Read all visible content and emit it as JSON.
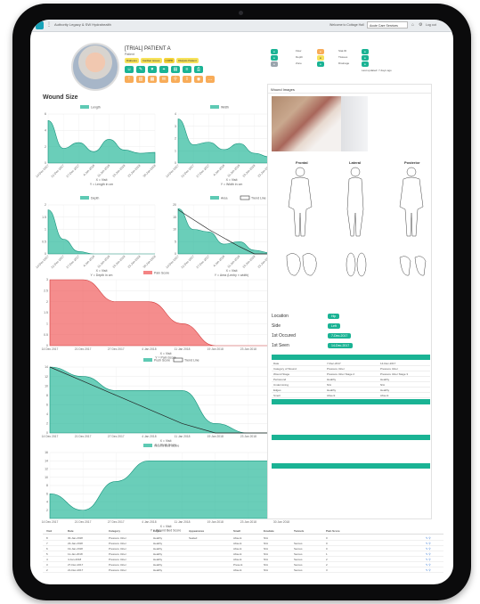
{
  "app": {
    "breadcrumb": "Authority Legacy & SW Hydrahealth",
    "welcome": "Welcome to Cottage Hall",
    "service_select": "Acute Care Services",
    "logout": "Log out"
  },
  "patient": {
    "name": "[TRIAL] PATIENT A",
    "subtitle": "Patient",
    "tags": [
      "Diabetes",
      "Cardiac issues",
      "COPD",
      "Dialysis Patient"
    ]
  },
  "info": {
    "labels": [
      "Flow",
      "Depth",
      "Zone",
      "Stat.ID",
      "Tissues",
      "Drainage"
    ],
    "last_updated": "Last updated: 7 days ago"
  },
  "wound_size_title": "Wound Size",
  "dates_short": [
    "14-Dec-2017",
    "21-Dec-2017",
    "27-Dec-2017",
    "4-Jan-2018",
    "11-Jan-2018",
    "19-Jan-2018",
    "23-Jan-2018",
    "30-Jan-2018"
  ],
  "dates_long": [
    "14 Dec 2017",
    "21 Dec 2017",
    "27 Dec 2017",
    "4 Jan 2018",
    "11 Jan 2018",
    "19 Jan 2018",
    "23 Jan 2018",
    "30 Jan 2018"
  ],
  "chart_data": [
    {
      "type": "area",
      "title": "Length",
      "x": [
        "14-Dec-2017",
        "21-Dec-2017",
        "27-Dec-2017",
        "4-Jan-2018",
        "11-Jan-2018",
        "19-Jan-2018",
        "23-Jan-2018",
        "30-Jan-2018"
      ],
      "series": [
        {
          "name": "Length",
          "values": [
            5.2,
            1.8,
            2.5,
            1.4,
            2.9,
            1.6,
            1.2,
            1.3
          ]
        }
      ],
      "xlabel": "X = Visit",
      "ylabel": "Y = Length in cm",
      "ylim": [
        0,
        6
      ]
    },
    {
      "type": "area",
      "title": "Width",
      "x": [
        "14-Dec-2017",
        "21-Dec-2017",
        "27-Dec-2017",
        "4-Jan-2018",
        "11-Jan-2018",
        "19-Jan-2018",
        "23-Jan-2018",
        "30-Jan-2018"
      ],
      "series": [
        {
          "name": "Width",
          "values": [
            3.6,
            1.5,
            1.7,
            1.1,
            1.6,
            0.8,
            0.5,
            0.4
          ]
        }
      ],
      "xlabel": "X = Visit",
      "ylabel": "Y = Width in cm",
      "ylim": [
        0,
        4
      ]
    },
    {
      "type": "area",
      "title": "Depth",
      "x": [
        "14-Dec-2017",
        "21-Dec-2017",
        "27-Dec-2017",
        "4-Jan-2018",
        "11-Jan-2018",
        "19-Jan-2018",
        "23-Jan-2018",
        "30-Jan-2018"
      ],
      "series": [
        {
          "name": "Depth",
          "values": [
            1.8,
            0.6,
            0.1,
            0.0,
            0.0,
            0.0,
            0.0,
            0.0
          ]
        }
      ],
      "xlabel": "X = Visit",
      "ylabel": "Y = Depth in cm",
      "ylim": [
        0,
        2
      ]
    },
    {
      "type": "area",
      "title": "Area / Trend Line",
      "x": [
        "14-Dec-2017",
        "21-Dec-2017",
        "27-Dec-2017",
        "4-Jan-2018",
        "11-Jan-2018",
        "19-Jan-2018",
        "23-Jan-2018",
        "30-Jan-2018"
      ],
      "series": [
        {
          "name": "Area",
          "values": [
            18.5,
            10.0,
            9.0,
            4.0,
            5.0,
            1.5,
            0.5,
            0.5
          ]
        },
        {
          "name": "Trend Line",
          "values": [
            18.0,
            14.0,
            10.0,
            6.5,
            3.0,
            0.0,
            0.0,
            0.0
          ]
        }
      ],
      "xlabel": "X = Visit",
      "ylabel": "Y = Area (Lenby × width)",
      "ylim": [
        0,
        20
      ]
    },
    {
      "type": "area",
      "title": "Pain Score",
      "x": [
        "14 Dec 2017",
        "21 Dec 2017",
        "27 Dec 2017",
        "4 Jan 2018",
        "11 Jan 2018",
        "19 Jan 2018",
        "23 Jan 2018",
        "30 Jan 2018"
      ],
      "series": [
        {
          "name": "Pain Score",
          "values": [
            3.0,
            3.0,
            2.0,
            2.0,
            1.0,
            0.0,
            0.0,
            0.0
          ]
        }
      ],
      "xlabel": "X = Visit",
      "ylabel": "Y = Pain Score",
      "ylim": [
        0,
        3
      ]
    },
    {
      "type": "area",
      "title": "Push Score / Trend Line",
      "x": [
        "14 Dec 2017",
        "21 Dec 2017",
        "27 Dec 2017",
        "4 Jan 2018",
        "11 Jan 2018",
        "19 Jan 2018",
        "23 Jan 2018",
        "30 Jan 2018"
      ],
      "series": [
        {
          "name": "Push Score",
          "values": [
            14,
            12,
            9,
            9,
            9,
            2,
            0,
            0
          ]
        },
        {
          "name": "Trend Line",
          "values": [
            14,
            11,
            8,
            5,
            2,
            0,
            0,
            0
          ]
        }
      ],
      "xlabel": "X = Visit",
      "ylabel": "Y = Push Score",
      "ylim": [
        0,
        14
      ]
    },
    {
      "type": "area",
      "title": "Wound Bed Score",
      "x": [
        "14 Dec 2017",
        "21 Dec 2017",
        "27 Dec 2017",
        "4 Jan 2018",
        "11 Jan 2018",
        "19 Jan 2018",
        "23 Jan 2018",
        "30 Jan 2018"
      ],
      "series": [
        {
          "name": "Wound Bed Score",
          "values": [
            6,
            2,
            9,
            14,
            14,
            14,
            14,
            14
          ]
        }
      ],
      "xlabel": "X = Visit",
      "ylabel": "Y = Wound Bed Score",
      "ylim": [
        0,
        16
      ]
    }
  ],
  "right_panel": {
    "title": "Wound Images",
    "views": [
      "Frontal",
      "Lateral",
      "Posterior"
    ],
    "location_label": "Location",
    "location_value": "Hip",
    "side_label": "Side",
    "side_value": "Left",
    "occurred_label": "1st Occured",
    "occurred_value": "7-Dec-2017",
    "seen_label": "1st Seen",
    "seen_value": "14-Dec-2017"
  },
  "assessment_rows": [
    [
      "Date",
      "7-Dec-2017",
      "14-Dec-2017"
    ],
    [
      "Category of Wound",
      "Pressure Ulcer",
      "Pressure Ulcer"
    ],
    [
      "Wound Stage",
      "Pressure Ulcer Stage 2",
      "Pressure Ulcer Stage 3"
    ],
    [
      "Periwound",
      "Healthy",
      "Healthy"
    ],
    [
      "Undermining",
      "N/A",
      "N/A"
    ],
    [
      "Edges",
      "Healthy",
      "Healthy"
    ],
    [
      "Smell",
      "Absent",
      "Absent"
    ]
  ],
  "bottom_table": {
    "headers": [
      "Visit",
      "Date",
      "Category",
      "Edges",
      "Appearance",
      "Smell",
      "Exudate",
      "Tunnels",
      "Pain Score"
    ],
    "rows": [
      [
        "8",
        "30-Jan-2018",
        "Pressure Ulcer",
        "Healthy",
        "Sealed",
        "Absent",
        "N/A",
        "",
        "0"
      ],
      [
        "7",
        "23-Jan-2018",
        "Pressure Ulcer",
        "Healthy",
        "",
        "Absent",
        "N/A",
        "Serous",
        "0"
      ],
      [
        "6",
        "19-Jan-2018",
        "Pressure Ulcer",
        "Healthy",
        "",
        "Absent",
        "N/A",
        "Serous",
        "0"
      ],
      [
        "5",
        "11-Jan-2018",
        "Pressure Ulcer",
        "Healthy",
        "",
        "Absent",
        "N/A",
        "Serous",
        "1"
      ],
      [
        "4",
        "4-Jan-2018",
        "Pressure Ulcer",
        "Healthy",
        "",
        "Absent",
        "N/A",
        "Serous",
        "2"
      ],
      [
        "3",
        "27-Dec-2017",
        "Pressure Ulcer",
        "Healthy",
        "",
        "Present",
        "N/A",
        "Serous",
        "2"
      ],
      [
        "2",
        "21-Dec-2017",
        "Pressure Ulcer",
        "Healthy",
        "",
        "Absent",
        "N/A",
        "Serous",
        "3"
      ]
    ]
  },
  "colors": {
    "teal": "#1ab394",
    "red": "#f05050",
    "orange": "#f8ac59",
    "dark": "#333333"
  }
}
